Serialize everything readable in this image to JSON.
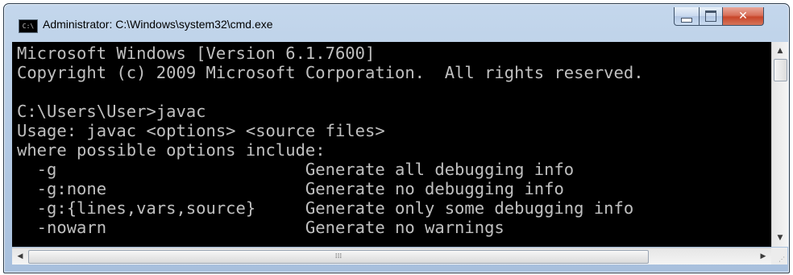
{
  "window": {
    "title": "Administrator: C:\\Windows\\system32\\cmd.exe",
    "icon_text": "C:\\"
  },
  "controls": {
    "minimize_icon": "minimize-icon",
    "maximize_icon": "maximize-icon",
    "close_icon": "close-icon",
    "close_glyph": "✕"
  },
  "console": {
    "lines": [
      "Microsoft Windows [Version 6.1.7600]",
      "Copyright (c) 2009 Microsoft Corporation.  All rights reserved.",
      "",
      "C:\\Users\\User>javac",
      "Usage: javac <options> <source files>",
      "where possible options include:",
      "  -g                         Generate all debugging info",
      "  -g:none                    Generate no debugging info",
      "  -g:{lines,vars,source}     Generate only some debugging info",
      "  -nowarn                    Generate no warnings"
    ]
  },
  "scrollbars": {
    "up_arrow": "▲",
    "down_arrow": "▼",
    "left_arrow": "◀",
    "right_arrow": "▶",
    "h_thumb_grip": "⁞⁞⁞"
  },
  "colors": {
    "console_bg": "#000000",
    "console_text": "#c0c0c0",
    "close_button": "#c8462a"
  }
}
